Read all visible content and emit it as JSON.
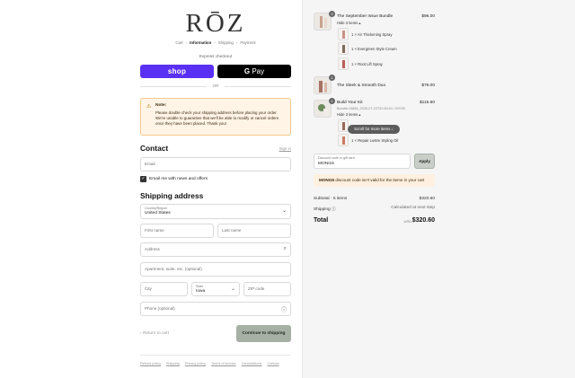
{
  "brand": {
    "logo": "RŌZ"
  },
  "breadcrumb": {
    "cart": "Cart",
    "information": "Information",
    "shipping": "Shipping",
    "payment": "Payment"
  },
  "express": {
    "label": "Express checkout",
    "shop": "shop",
    "gpay_g": "G",
    "gpay_pay": "Pay",
    "or": "OR"
  },
  "note": {
    "title": "Note:",
    "lines": [
      "Please double check your shipping address before placing your order.",
      "We're unable to guarantee that we'll be able to modify or cancel orders",
      "once they have been placed. Thank you!"
    ]
  },
  "contact": {
    "heading": "Contact",
    "sign_in": "Sign in",
    "email_placeholder": "Email",
    "newsletter_label": "Email me with news and offers",
    "newsletter_checked": true
  },
  "shipping": {
    "heading": "Shipping address",
    "country_label": "Country/Region",
    "country_value": "United States",
    "first_name": "First name",
    "last_name": "Last name",
    "address": "Address",
    "apartment": "Apartment, suite, etc. (optional)",
    "city": "City",
    "state_label": "State",
    "state_value": "Iowa",
    "zip": "ZIP code",
    "phone": "Phone (optional)"
  },
  "actions": {
    "return": "Return to cart",
    "continue": "Continue to shipping"
  },
  "footer": [
    "Refund policy",
    "Shipping",
    "Privacy policy",
    "Terms of service",
    "Cancellations",
    "Contact"
  ],
  "cart": {
    "items": [
      {
        "qty": "3",
        "name": "The September Issue Bundle",
        "price": "$96.00",
        "hide": "Hide 3 items ▴",
        "subitems": [
          "1 × Air Thickening Spray",
          "1 × Evergreen Style Cream",
          "1 × Root Lift Spray"
        ]
      },
      {
        "qty": "1",
        "name": "The Sleek & Smooth Duo",
        "price": "$79.00"
      },
      {
        "qty": "1",
        "name": "Build Your Kit",
        "price": "$115.60",
        "meta": "Bundle:19856_2025-07-23T20:54:51 / BYOB",
        "hide": "Hide 3 items ▴",
        "subitems": [
          "1 × Scalp Oil",
          "1 × Repair Lustre Styling Oil"
        ]
      }
    ],
    "scroll_hint": "Scroll for more items ↓"
  },
  "discount": {
    "label": "Discount code or gift card",
    "value": "MONI15",
    "apply": "Apply",
    "error_code": "MONI15",
    "error_text": " discount code isn't valid for the items in your cart"
  },
  "summary": {
    "subtotal_label": "Subtotal · 5 items",
    "subtotal_value": "$320.60",
    "shipping_label": "Shipping ⓘ",
    "shipping_value": "Calculated at next step",
    "total_label": "Total",
    "currency": "USD",
    "total_value": "$320.60"
  }
}
